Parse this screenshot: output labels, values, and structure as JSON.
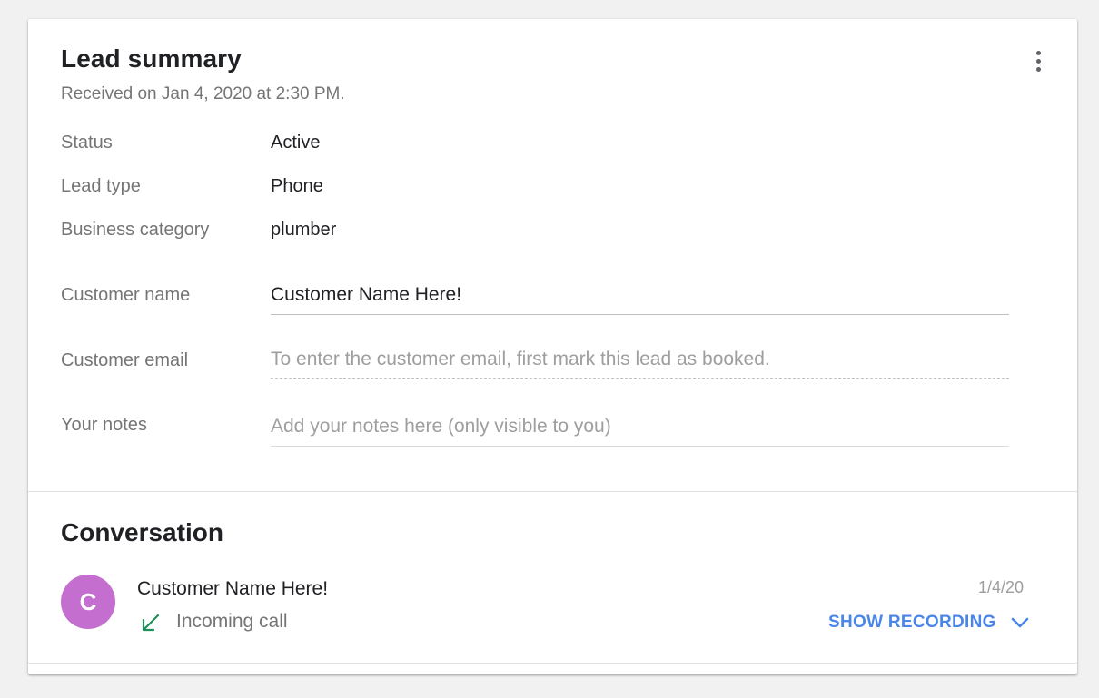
{
  "card": {
    "title": "Lead summary",
    "received": "Received on Jan 4, 2020 at 2:30 PM.",
    "more_icon": "more-vert-icon",
    "details": [
      {
        "label": "Status",
        "value": "Active"
      },
      {
        "label": "Lead type",
        "value": "Phone"
      },
      {
        "label": "Business category",
        "value": "plumber"
      }
    ],
    "customer_name": {
      "label": "Customer name",
      "value": "Customer Name Here!"
    },
    "customer_email": {
      "label": "Customer email",
      "placeholder": "To enter the customer email, first mark this lead as booked."
    },
    "notes": {
      "label": "Your notes",
      "placeholder": "Add your notes here (only visible to you)"
    }
  },
  "conversation": {
    "title": "Conversation",
    "avatar_letter": "C",
    "avatar_color": "#c46fd0",
    "name": "Customer Name Here!",
    "call_icon": "incoming-call-arrow-icon",
    "call_icon_color": "#1e8e5a",
    "call_type": "Incoming call",
    "date": "1/4/20",
    "show_recording_label": "SHOW RECORDING",
    "link_color": "#4a86e8"
  }
}
